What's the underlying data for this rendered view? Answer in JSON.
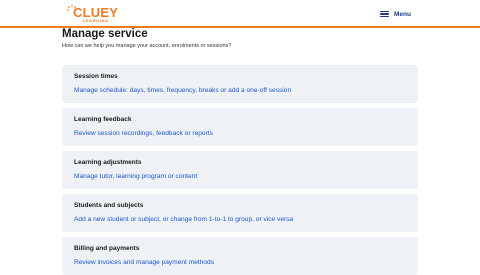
{
  "header": {
    "logo_text": "CLUEY",
    "logo_subtext": "LEARNING",
    "menu_label": "Menu",
    "accent_color": "#f07a22",
    "brand_blue": "#1b3a8e"
  },
  "page": {
    "title": "Manage service",
    "subtitle": "How can we help you manage your account, enrolments or sessions?"
  },
  "cards": [
    {
      "title": "Session times",
      "link": "Manage schedule: days, times, frequency, breaks or add a one-off session"
    },
    {
      "title": "Learning feedback",
      "link": "Review session recordings, feedback or reports"
    },
    {
      "title": "Learning adjustments",
      "link": "Manage tutor, learning program or content"
    },
    {
      "title": "Students and subjects",
      "link": "Add a new student or subject, or change from 1-to-1 to group, or vice versa"
    },
    {
      "title": "Billing and payments",
      "link": "Review invoices and manage payment methods"
    }
  ],
  "colors": {
    "card_background": "#eef2f7",
    "link": "#1e55c9",
    "text": "#1a1a1a"
  }
}
